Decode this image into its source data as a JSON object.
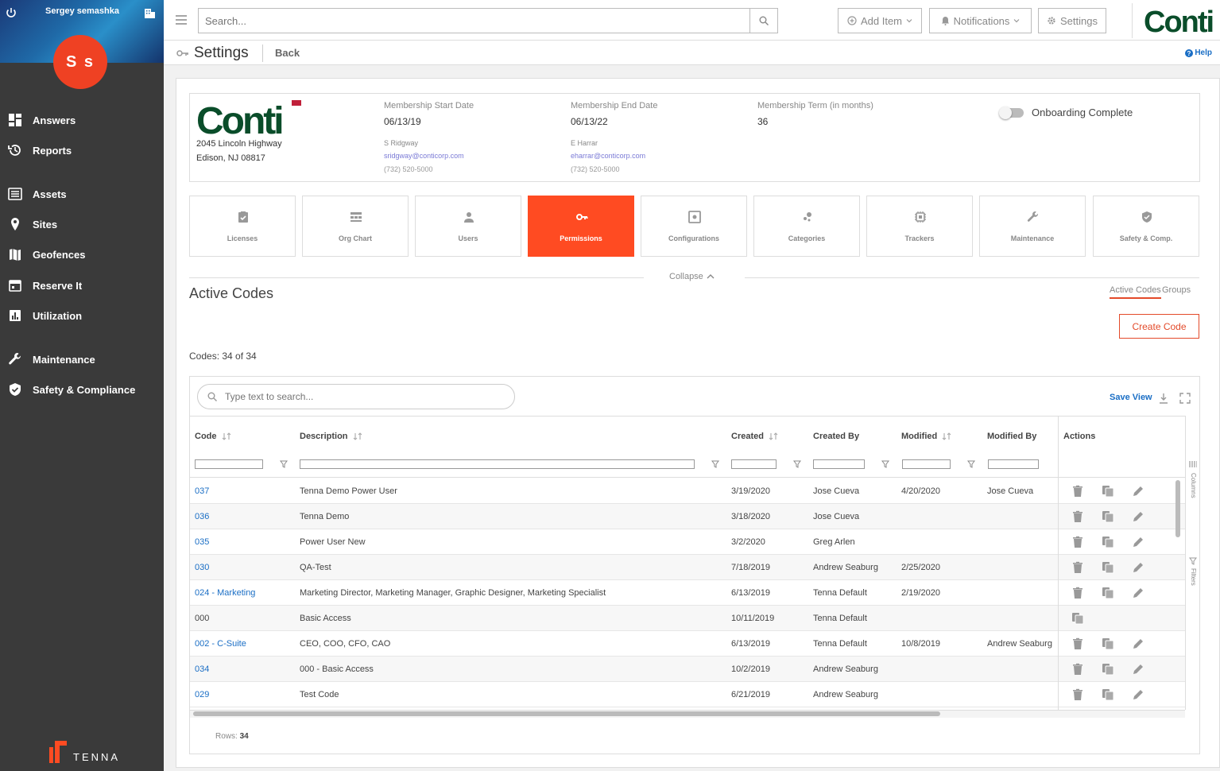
{
  "user": {
    "name": "Sergey semashka",
    "initials": "S s"
  },
  "nav": [
    {
      "label": "Answers",
      "icon": "dashboard-icon"
    },
    {
      "label": "Reports",
      "icon": "history-icon"
    },
    {
      "label": "Assets",
      "icon": "list-icon"
    },
    {
      "label": "Sites",
      "icon": "location-pin-icon"
    },
    {
      "label": "Geofences",
      "icon": "map-icon"
    },
    {
      "label": "Reserve It",
      "icon": "calendar-icon"
    },
    {
      "label": "Utilization",
      "icon": "bar-chart-icon"
    },
    {
      "label": "Maintenance",
      "icon": "wrench-icon"
    },
    {
      "label": "Safety & Compliance",
      "icon": "shield-check-icon"
    }
  ],
  "brand": {
    "name": "TENNA"
  },
  "topbar": {
    "search_placeholder": "Search...",
    "add_item": "Add Item",
    "notifications": "Notifications",
    "settings": "Settings",
    "logo_text": "Conti"
  },
  "titlebar": {
    "title": "Settings",
    "back": "Back",
    "help": "Help"
  },
  "company": {
    "logo_text": "Conti",
    "address_line1": "2045 Lincoln Highway",
    "address_line2": "Edison, NJ 08817",
    "start_label": "Membership Start Date",
    "start_value": "06/13/19",
    "end_label": "Membership End Date",
    "end_value": "06/13/22",
    "term_label": "Membership Term (in months)",
    "term_value": "36",
    "contact1": {
      "name": "S Ridgway",
      "email": "sridgway@conticorp.com",
      "phone": "(732) 520-5000"
    },
    "contact2": {
      "name": "E Harrar",
      "email": "eharrar@conticorp.com",
      "phone": "(732) 520-5000"
    },
    "onboarding": "Onboarding Complete",
    "onboarding_on": false
  },
  "tiles": [
    {
      "label": "Licenses",
      "icon": "clipboard-check-icon",
      "active": false
    },
    {
      "label": "Org Chart",
      "icon": "org-chart-icon",
      "active": false
    },
    {
      "label": "Users",
      "icon": "person-icon",
      "active": false
    },
    {
      "label": "Permissions",
      "icon": "key-icon",
      "active": true
    },
    {
      "label": "Configurations",
      "icon": "configuration-icon",
      "active": false
    },
    {
      "label": "Categories",
      "icon": "categories-icon",
      "active": false
    },
    {
      "label": "Trackers",
      "icon": "chip-icon",
      "active": false
    },
    {
      "label": "Maintenance",
      "icon": "wrench-icon",
      "active": false
    },
    {
      "label": "Safety & Comp.",
      "icon": "shield-icon",
      "active": false
    }
  ],
  "collapse": "Collapse",
  "section": {
    "title": "Active Codes",
    "tab_active": "Active Codes",
    "tab_groups": "Groups",
    "create": "Create Code",
    "count": "Codes: 34 of 34"
  },
  "grid": {
    "search_placeholder": "Type text to search...",
    "save_view": "Save View",
    "columns": [
      "Code",
      "Description",
      "Created",
      "Created By",
      "Modified",
      "Modified By",
      "Actions"
    ],
    "side_columns": "Columns",
    "side_filters": "Filters",
    "rows_label": "Rows:",
    "rows_value": "34",
    "rows": [
      {
        "code": "037",
        "desc": "Tenna Demo Power User",
        "created": "3/19/2020",
        "created_by": "Jose Cueva",
        "modified": "4/20/2020",
        "modified_by": "Jose Cueva",
        "link": true,
        "full": true
      },
      {
        "code": "036",
        "desc": "Tenna Demo",
        "created": "3/18/2020",
        "created_by": "Jose Cueva",
        "modified": "",
        "modified_by": "",
        "link": true,
        "full": true
      },
      {
        "code": "035",
        "desc": "Power User New",
        "created": "3/2/2020",
        "created_by": "Greg Arlen",
        "modified": "",
        "modified_by": "",
        "link": true,
        "full": true
      },
      {
        "code": "030",
        "desc": "QA-Test",
        "created": "7/18/2019",
        "created_by": "Andrew Seaburg",
        "modified": "2/25/2020",
        "modified_by": "",
        "link": true,
        "full": true
      },
      {
        "code": "024 - Marketing",
        "desc": "Marketing Director, Marketing Manager, Graphic Designer, Marketing Specialist",
        "created": "6/13/2019",
        "created_by": "Tenna Default",
        "modified": "2/19/2020",
        "modified_by": "",
        "link": true,
        "full": true
      },
      {
        "code": "000",
        "desc": "Basic Access",
        "created": "10/11/2019",
        "created_by": "Tenna Default",
        "modified": "",
        "modified_by": "",
        "link": false,
        "full": false
      },
      {
        "code": "002 - C-Suite",
        "desc": "CEO, COO, CFO, CAO",
        "created": "6/13/2019",
        "created_by": "Tenna Default",
        "modified": "10/8/2019",
        "modified_by": "Andrew Seaburg",
        "link": true,
        "full": true
      },
      {
        "code": "034",
        "desc": "000 - Basic Access",
        "created": "10/2/2019",
        "created_by": "Andrew Seaburg",
        "modified": "",
        "modified_by": "",
        "link": true,
        "full": true
      },
      {
        "code": "029",
        "desc": "Test Code",
        "created": "6/21/2019",
        "created_by": "Andrew Seaburg",
        "modified": "",
        "modified_by": "",
        "link": true,
        "full": true
      }
    ]
  },
  "colors": {
    "accent": "#ff4b22",
    "link": "#1a6ec5",
    "sidebar": "#3a3a3a",
    "logo": "#0a4d2a"
  }
}
